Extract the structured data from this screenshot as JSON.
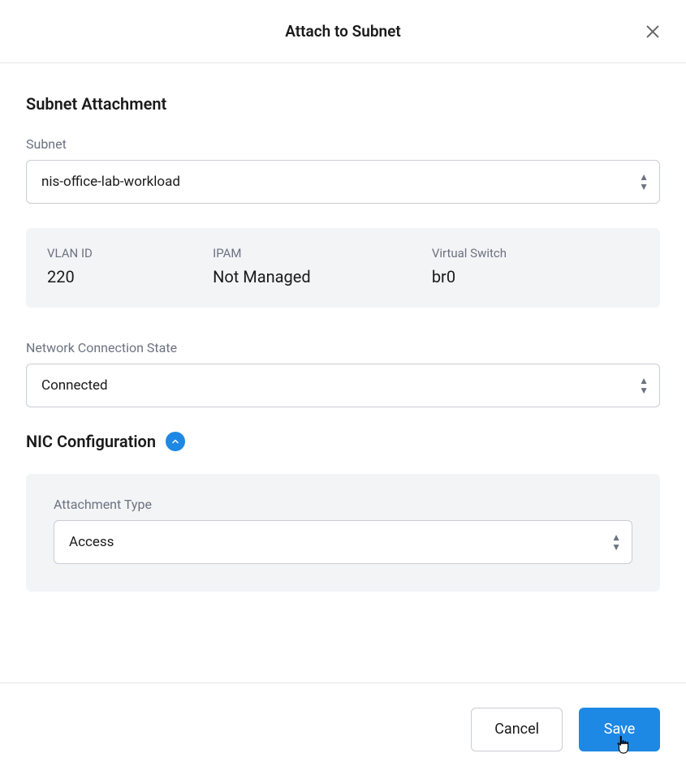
{
  "header": {
    "title": "Attach to Subnet"
  },
  "section": {
    "heading": "Subnet Attachment",
    "subnet_label": "Subnet",
    "subnet_value": "nis-office-lab-workload",
    "info": {
      "vlan_label": "VLAN ID",
      "vlan_value": "220",
      "ipam_label": "IPAM",
      "ipam_value": "Not Managed",
      "vswitch_label": "Virtual Switch",
      "vswitch_value": "br0"
    },
    "conn_state_label": "Network Connection State",
    "conn_state_value": "Connected",
    "nic_heading": "NIC Configuration",
    "attachment_type_label": "Attachment Type",
    "attachment_type_value": "Access"
  },
  "footer": {
    "cancel": "Cancel",
    "save": "Save"
  }
}
